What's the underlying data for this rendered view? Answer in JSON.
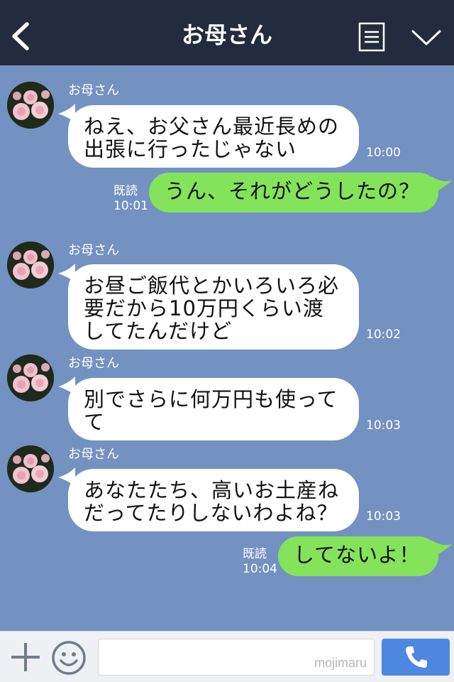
{
  "header": {
    "title": "お母さん",
    "back_icon": "chevron-left-icon",
    "menu_icon": "menu-list-icon",
    "collapse_icon": "chevron-down-icon"
  },
  "messages": [
    {
      "type": "incoming",
      "sender": "お母さん",
      "text": "ねえ、お父さん最近長めの\n出張に行ったじゃない",
      "time": "10:00"
    },
    {
      "type": "outgoing",
      "read": "既読",
      "time": "10:01",
      "text": "うん、それがどうしたの？"
    },
    {
      "type": "incoming",
      "sender": "お母さん",
      "text": "お昼ご飯代とかいろいろ必\n要だから10万円くらい渡\nしてたんだけど",
      "time": "10:02"
    },
    {
      "type": "incoming",
      "sender": "お母さん",
      "text": "別でさらに何万円も使って\nて",
      "time": "10:03"
    },
    {
      "type": "incoming",
      "sender": "お母さん",
      "text": "あなたたち、高いお土産ね\nだってたりしないわよね？",
      "time": "10:03"
    },
    {
      "type": "outgoing",
      "read": "既読",
      "time": "10:04",
      "text": "してないよ！"
    }
  ],
  "footer": {
    "input_placeholder": "",
    "watermark": "mojimaru",
    "plus_icon": "plus-icon",
    "emoji_icon": "smiley-icon",
    "call_icon": "phone-icon"
  },
  "colors": {
    "header_bg": "#232b3e",
    "chat_bg": "#7392c2",
    "incoming_bubble": "#ffffff",
    "outgoing_bubble": "#84e35a",
    "call_button": "#4d87e0"
  }
}
